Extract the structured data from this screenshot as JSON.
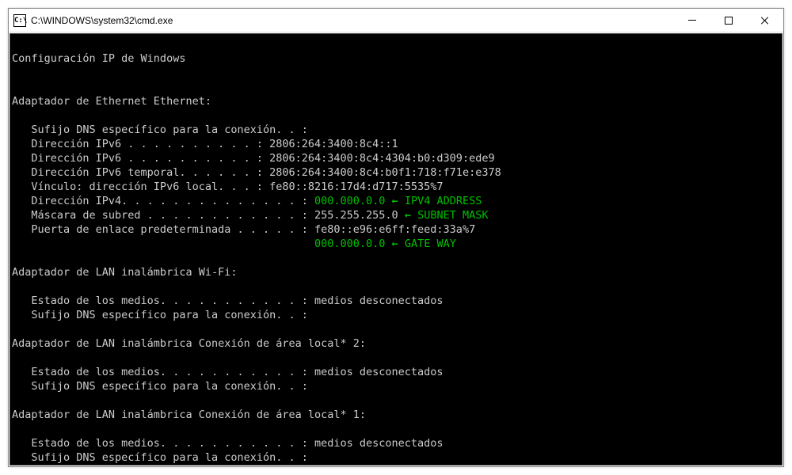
{
  "window": {
    "title": "C:\\WINDOWS\\system32\\cmd.exe",
    "iconLabel": "C:\\"
  },
  "header": "Configuración IP de Windows",
  "adapterEthernet": "Adaptador de Ethernet Ethernet:",
  "ethernet": {
    "dnsSuffix": "   Sufijo DNS específico para la conexión. . :",
    "ipv6a": "   Dirección IPv6 . . . . . . . . . . : 2806:264:3400:8c4::1",
    "ipv6b": "   Dirección IPv6 . . . . . . . . . . : 2806:264:3400:8c4:4304:b0:d309:ede9",
    "ipv6temp": "   Dirección IPv6 temporal. . . . . . : 2806:264:3400:8c4:b0f1:718:f71e:e378",
    "linkLocal": "   Vínculo: dirección IPv6 local. . . : fe80::8216:17d4:d717:5535%7",
    "ipv4Label": "   Dirección IPv4. . . . . . . . . . . . . . : ",
    "ipv4Value": "000.000.0.0",
    "subnetLabel": "   Máscara de subred . . . . . . . . . . . . : ",
    "subnetValue": "255.255.255.0",
    "gatewayLabel": "   Puerta de enlace predeterminada . . . . . : fe80::e96:e6ff:feed:33a%7",
    "gatewayPad": "                                               ",
    "gatewayValue": "000.000.0.0"
  },
  "annotations": {
    "ipv4": "IPV4 ADDRESS",
    "subnet": "SUBNET MASK",
    "gateway": "GATE WAY",
    "arrow": " ← "
  },
  "adapterWifi": "Adaptador de LAN inalámbrica Wi-Fi:",
  "adapterLocal2": "Adaptador de LAN inalámbrica Conexión de área local* 2:",
  "adapterLocal1": "Adaptador de LAN inalámbrica Conexión de área local* 1:",
  "disconnected": {
    "mediaState": "   Estado de los medios. . . . . . . . . . . : medios desconectados",
    "dnsSuffix": "   Sufijo DNS específico para la conexión. . :"
  }
}
